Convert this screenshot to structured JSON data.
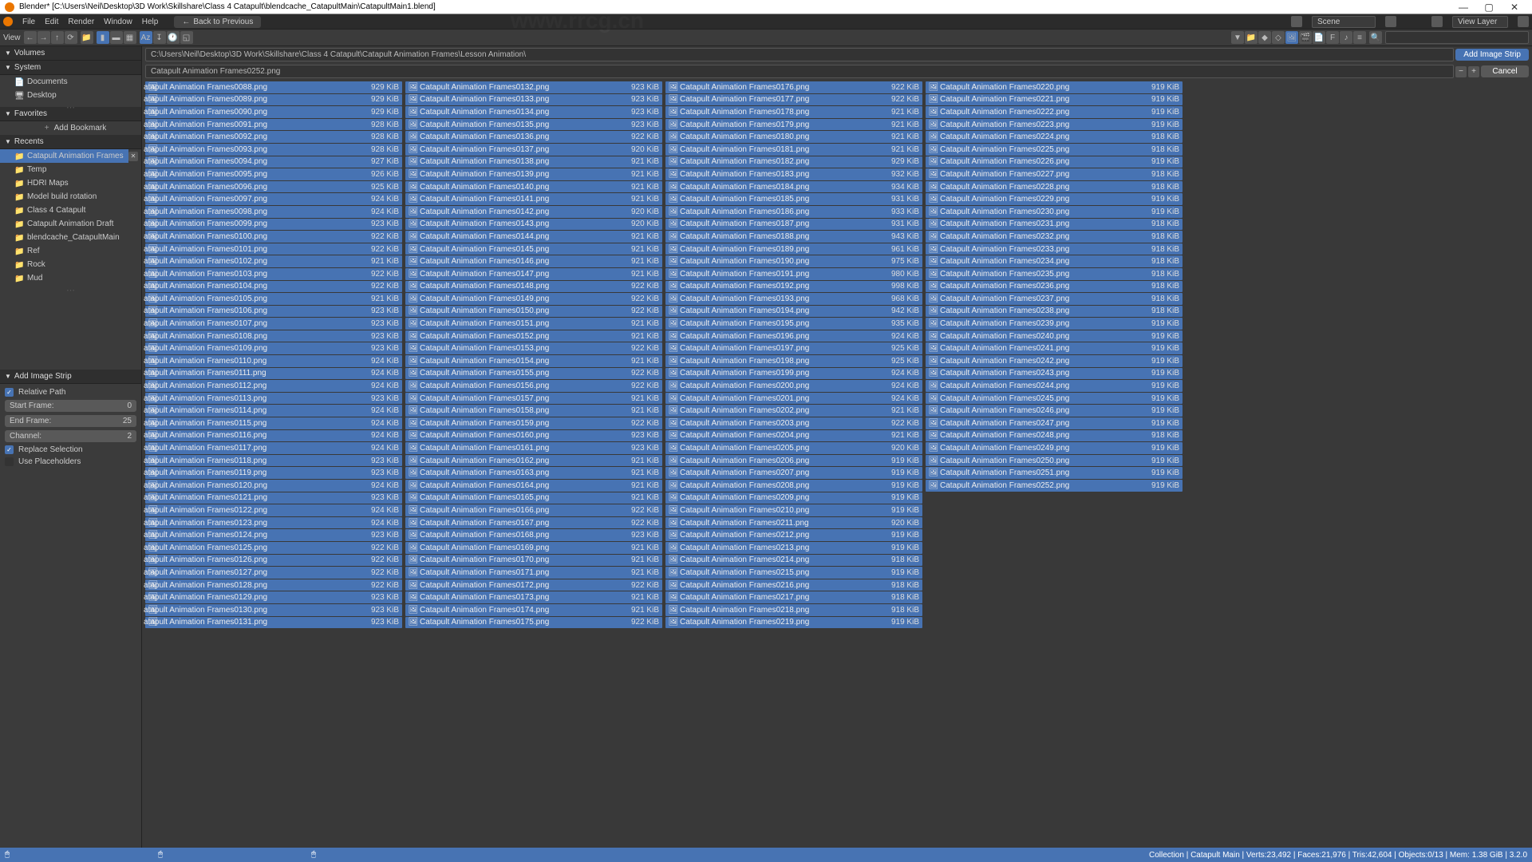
{
  "window": {
    "title": "Blender* [C:\\Users\\Neil\\Desktop\\3D Work\\Skillshare\\Class 4 Catapult\\blendcache_CatapultMain\\CatapultMain1.blend]"
  },
  "menu": {
    "items": [
      "File",
      "Edit",
      "Render",
      "Window",
      "Help"
    ],
    "back": "Back to Previous",
    "scene": "Scene",
    "viewlayer": "View Layer"
  },
  "toolbar": {
    "view": "View"
  },
  "path": {
    "dir": "C:\\Users\\Neil\\Desktop\\3D Work\\Skillshare\\Class 4 Catapult\\Catapult Animation Frames\\Lesson Animation\\",
    "file": "Catapult Animation Frames0252.png",
    "add": "Add Image Strip",
    "cancel": "Cancel"
  },
  "sidebar": {
    "volumes": "Volumes",
    "system": "System",
    "sys_items": [
      "Documents",
      "Desktop"
    ],
    "favorites": "Favorites",
    "add_bm": "Add Bookmark",
    "recents": "Recents",
    "recent_items": [
      "Catapult Animation Frames",
      "Temp",
      "HDRI Maps",
      "Model build rotation",
      "Class 4 Catapult",
      "Catapult Animation Draft",
      "blendcache_CatapultMain",
      "Ref",
      "Rock",
      "Mud"
    ]
  },
  "options": {
    "header": "Add Image Strip",
    "relative": "Relative Path",
    "start": "Start Frame:",
    "start_v": "0",
    "end": "End Frame:",
    "end_v": "25",
    "channel": "Channel:",
    "channel_v": "2",
    "replace": "Replace Selection",
    "placeholders": "Use Placeholders"
  },
  "columns": [
    {
      "prefix": "atapult Animation Frames",
      "start": 88,
      "end": 131,
      "sizes": [
        "929",
        "929",
        "929",
        "928",
        "928",
        "928",
        "927",
        "926",
        "925",
        "924",
        "924",
        "923",
        "922",
        "922",
        "921",
        "922",
        "922",
        "921",
        "923",
        "923",
        "923",
        "923",
        "924",
        "924",
        "924",
        "923",
        "924",
        "924",
        "924",
        "924",
        "923",
        "923",
        "924",
        "923",
        "924",
        "924",
        "923",
        "922",
        "922",
        "922",
        "922",
        "923",
        "923",
        "923"
      ]
    },
    {
      "prefix": "Catapult Animation Frames",
      "start": 132,
      "end": 175,
      "sizes": [
        "923",
        "923",
        "923",
        "923",
        "922",
        "920",
        "921",
        "921",
        "921",
        "921",
        "920",
        "920",
        "921",
        "921",
        "921",
        "921",
        "922",
        "922",
        "922",
        "921",
        "921",
        "922",
        "921",
        "922",
        "922",
        "921",
        "921",
        "922",
        "923",
        "923",
        "921",
        "921",
        "921",
        "921",
        "922",
        "922",
        "923",
        "921",
        "921",
        "921",
        "922",
        "921",
        "921",
        "922"
      ]
    },
    {
      "prefix": "Catapult Animation Frames",
      "start": 176,
      "end": 219,
      "sizes": [
        "922",
        "922",
        "921",
        "921",
        "921",
        "921",
        "929",
        "932",
        "934",
        "931",
        "933",
        "931",
        "943",
        "961",
        "975",
        "980",
        "998",
        "968",
        "942",
        "935",
        "924",
        "925",
        "925",
        "924",
        "924",
        "924",
        "921",
        "922",
        "921",
        "920",
        "919",
        "919",
        "919",
        "919",
        "919",
        "920",
        "919",
        "919",
        "918",
        "919",
        "918",
        "918",
        "918",
        "919"
      ]
    },
    {
      "prefix": "Catapult Animation Frames",
      "start": 220,
      "end": 252,
      "sizes": [
        "919",
        "919",
        "919",
        "919",
        "918",
        "918",
        "919",
        "918",
        "918",
        "919",
        "919",
        "918",
        "918",
        "918",
        "918",
        "918",
        "918",
        "918",
        "918",
        "919",
        "919",
        "919",
        "919",
        "919",
        "919",
        "919",
        "919",
        "919",
        "918",
        "919",
        "919",
        "919",
        "919"
      ]
    }
  ],
  "status": "Collection | Catapult Main | Verts:23,492 | Faces:21,976 | Tris:42,604 | Objects:0/13 | Mem: 1.38 GiB | 3.2.0",
  "watermark": "www.rrcg.cn"
}
